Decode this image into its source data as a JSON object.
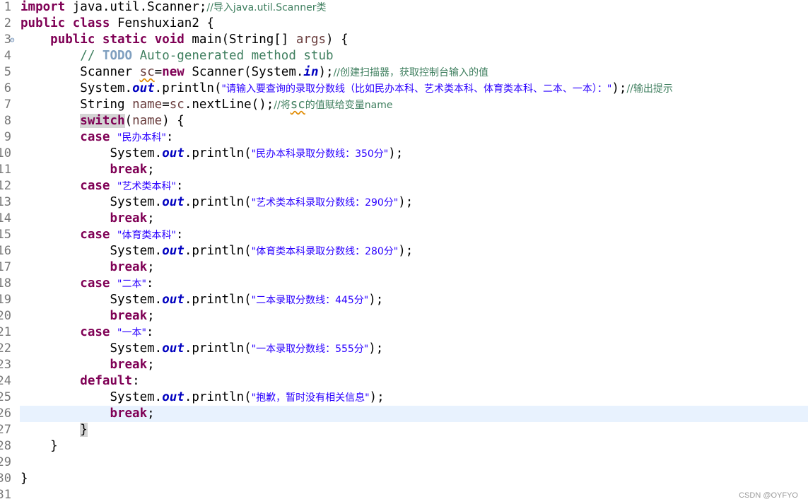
{
  "editor": {
    "language": "java",
    "current_line": 26,
    "lines": [
      {
        "n": "1"
      },
      {
        "n": "2"
      },
      {
        "n": "3",
        "fold": true
      },
      {
        "n": "4"
      },
      {
        "n": "5"
      },
      {
        "n": "6"
      },
      {
        "n": "7"
      },
      {
        "n": "8"
      },
      {
        "n": "9"
      },
      {
        "n": "10"
      },
      {
        "n": "11"
      },
      {
        "n": "12"
      },
      {
        "n": "13"
      },
      {
        "n": "14"
      },
      {
        "n": "15"
      },
      {
        "n": "16"
      },
      {
        "n": "17"
      },
      {
        "n": "18"
      },
      {
        "n": "19"
      },
      {
        "n": "20"
      },
      {
        "n": "21"
      },
      {
        "n": "22"
      },
      {
        "n": "23"
      },
      {
        "n": "24"
      },
      {
        "n": "25"
      },
      {
        "n": "26"
      },
      {
        "n": "27"
      },
      {
        "n": "28"
      },
      {
        "n": "29"
      },
      {
        "n": "30"
      },
      {
        "n": "31"
      }
    ],
    "fold_icon": "collapse-minus-icon",
    "code": {
      "l1_import": "import",
      "l1_pkg": " java.util.Scanner;",
      "l1_cmt": "//导入java.util.Scanner类",
      "l2_public": "public",
      "l2_class": "class",
      "l2_name": " Fenshuxian2 {",
      "l3_public": "public",
      "l3_static": "static",
      "l3_void": "void",
      "l3_sig_a": " main(String[] ",
      "l3_args": "args",
      "l3_sig_b": ") {",
      "l4_cmt_a": "// ",
      "l4_todo": "TODO",
      "l4_cmt_b": " Auto-generated method stub",
      "l5_a": "Scanner ",
      "l5_sc": "sc",
      "l5_b": "=",
      "l5_new": "new",
      "l5_c": " Scanner(System.",
      "l5_in": "in",
      "l5_d": ");",
      "l5_cmt": "//创建扫描器，获取控制台输入的值",
      "l6_a": "System.",
      "l6_out": "out",
      "l6_b": ".println(",
      "l6_str": "\"请输入要查询的录取分数线（比如民办本科、艺术类本科、体育类本科、二本、一本）：\"",
      "l6_c": ");",
      "l6_cmt": "//输出提示",
      "l7_a": "String ",
      "l7_name": "name",
      "l7_b": "=",
      "l7_sc": "sc",
      "l7_c": ".nextLine();",
      "l7_cmt_a": "//将",
      "l7_cmt_sc": "sc",
      "l7_cmt_b": "的值赋给变量name",
      "l8_switch": "switch",
      "l8_a": "(",
      "l8_name": "name",
      "l8_b": ") {",
      "case_kw": "case",
      "break_kw": "break",
      "semi": ";",
      "colon": ":",
      "sys": "System.",
      "out": "out",
      "println": ".println(",
      "close": ");",
      "c1_label": "\"民办本科\"",
      "c1_msg": "\"民办本科录取分数线：350分\"",
      "c2_label": "\"艺术类本科\"",
      "c2_msg": "\"艺术类本科录取分数线：290分\"",
      "c3_label": "\"体育类本科\"",
      "c3_msg": "\"体育类本科录取分数线：280分\"",
      "c4_label": "\"二本\"",
      "c4_msg": "\"二本录取分数线：445分\"",
      "c5_label": "\"一本\"",
      "c5_msg": "\"一本录取分数线：555分\"",
      "default_kw": "default",
      "default_msg": "\"抱歉，暂时没有相关信息\"",
      "brace_close": "}"
    }
  },
  "watermark": "CSDN @OYFYO"
}
